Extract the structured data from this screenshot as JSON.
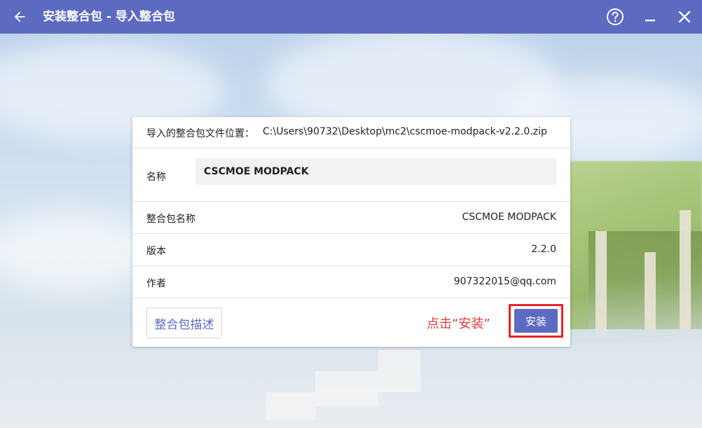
{
  "titlebar": {
    "title": "安装整合包 - 导入整合包",
    "back_icon": "arrow-left-icon",
    "help_icon": "help-circle-icon",
    "minimize_icon": "minimize-icon",
    "close_icon": "close-icon",
    "background_color": "#5c6bc0"
  },
  "dialog": {
    "file_location_label": "导入的整合包文件位置：",
    "file_location_value": "C:\\Users\\90732\\Desktop\\mc2\\cscmoe-modpack-v2.2.0.zip",
    "name_label": "名称",
    "name_value": "CSCMOE MODPACK",
    "details": [
      {
        "label": "整合包名称",
        "value": "CSCMOE MODPACK"
      },
      {
        "label": "版本",
        "value": "2.2.0"
      },
      {
        "label": "作者",
        "value": "907322015@qq.com"
      }
    ],
    "description_button": "整合包描述",
    "install_button": "安装",
    "accent_color": "#5c6bc0"
  },
  "annotation": {
    "hint_text": "点击“安装”",
    "color": "#e8232a"
  }
}
